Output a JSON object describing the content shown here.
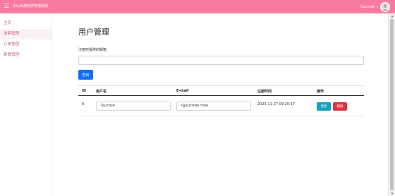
{
  "topbar": {
    "menu_icon": "hamburger-icon",
    "title": "乐山大佛热供管理系统",
    "user_name": "Sucrose",
    "user_caret": "▾",
    "avatar_icon": "user-avatar-icon"
  },
  "sidebar": {
    "items": [
      {
        "label": "主页"
      },
      {
        "label": "游客管理"
      },
      {
        "label": "订单管理"
      },
      {
        "label": "套餐管理"
      }
    ]
  },
  "main": {
    "page_title": "用户管理",
    "email_label": "注册时提供的邮箱",
    "email_value": "",
    "query_label": "查询"
  },
  "table": {
    "headers": [
      "ID",
      "用户名",
      "E-mail",
      "注册时间",
      "操作"
    ],
    "rows": [
      {
        "id": "6",
        "username": "Sucrose",
        "email": "i@sucrose.moe",
        "registered": "2023-11-27 09:20:17",
        "update_label": "更新",
        "delete_label": "删除"
      }
    ]
  },
  "colors": {
    "topbar": "#f77ba0",
    "sidebar_text": "#c2668a",
    "primary": "#0d6efd",
    "info": "#17a2b8",
    "danger": "#dc3545"
  }
}
